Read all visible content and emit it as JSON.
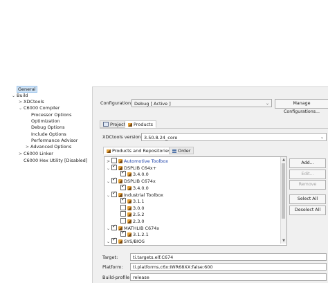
{
  "tree": {
    "items": [
      {
        "label": "General",
        "toggle": ""
      },
      {
        "label": "Build",
        "toggle": "⌄"
      },
      {
        "label": "XDCtools",
        "toggle": ">"
      },
      {
        "label": "C6000 Compiler",
        "toggle": "⌄"
      },
      {
        "label": "Processor Options",
        "toggle": ""
      },
      {
        "label": "Optimization",
        "toggle": ""
      },
      {
        "label": "Debug Options",
        "toggle": ""
      },
      {
        "label": "Include Options",
        "toggle": ""
      },
      {
        "label": "Performance Advisor",
        "toggle": ""
      },
      {
        "label": "Advanced Options",
        "toggle": ">"
      },
      {
        "label": "C6000 Linker",
        "toggle": ">"
      },
      {
        "label": "C6000 Hex Utility  [Disabled]",
        "toggle": ""
      }
    ]
  },
  "config": {
    "label": "Configuration:",
    "value": "Debug  [ Active ]",
    "manage_button": "Manage Configurations..."
  },
  "tabs": {
    "project": "Project",
    "products": "Products"
  },
  "xdc": {
    "label": "XDCtools version:",
    "value": "3.50.8.24_core"
  },
  "subtabs": {
    "products_repos": "Products and Repositories",
    "order": "Order"
  },
  "products": [
    {
      "label": "Automotive Toolbox",
      "checked": false,
      "expanded": ">",
      "link": true
    },
    {
      "label": "DSPLIB C64x+",
      "checked": true,
      "expanded": "⌄"
    },
    {
      "label": "3.4.0.0",
      "checked": true,
      "child": true
    },
    {
      "label": "DSPLIB C674x",
      "checked": true,
      "expanded": "⌄"
    },
    {
      "label": "3.4.0.0",
      "checked": true,
      "child": true
    },
    {
      "label": "Industrial Toolbox",
      "checked": true,
      "expanded": "⌄"
    },
    {
      "label": "3.1.1",
      "checked": true,
      "child": true
    },
    {
      "label": "3.0.0",
      "checked": false,
      "child": true
    },
    {
      "label": "2.5.2",
      "checked": false,
      "child": true
    },
    {
      "label": "2.3.0",
      "checked": false,
      "child": true
    },
    {
      "label": "MATHLIB C674x",
      "checked": true,
      "expanded": "⌄"
    },
    {
      "label": "3.1.2.1",
      "checked": true,
      "child": true
    },
    {
      "label": "SYS/BIOS",
      "checked": true,
      "expanded": "⌄"
    }
  ],
  "side_buttons": {
    "add": "Add...",
    "edit": "Edit...",
    "remove": "Remove",
    "select_all": "Select All",
    "deselect_all": "Deselect All"
  },
  "bottom": {
    "target_label": "Target:",
    "target_value": "ti.targets.elf.C674",
    "platform_label": "Platform:",
    "platform_value": "ti.platforms.c6x:IWR68XX:false:600",
    "build_profile_label": "Build-profile:",
    "build_profile_value": "release"
  }
}
